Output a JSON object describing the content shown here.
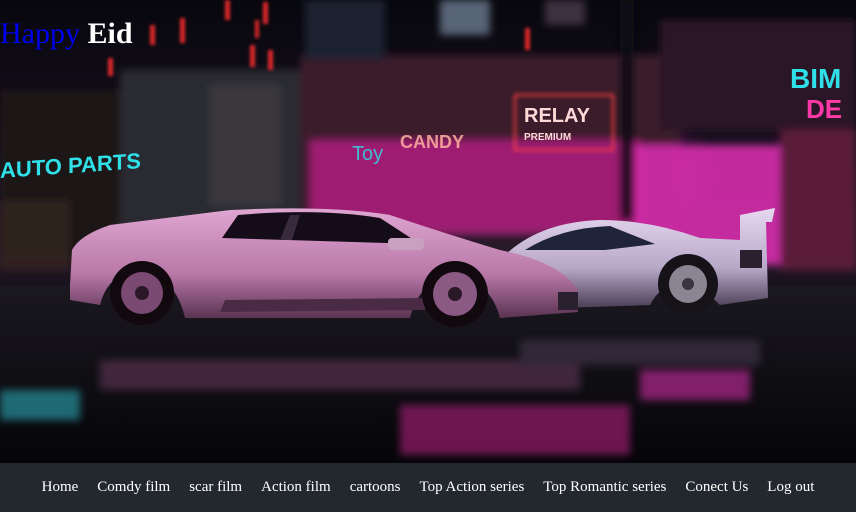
{
  "header": {
    "title_word_1": "Happy",
    "title_word_2": "Eid"
  },
  "hero": {
    "signs": {
      "auto_parts": "AUTO PARTS",
      "relay": "RELAY",
      "relay_sub": "PREMIUM",
      "toy": "Toy",
      "candy": "CANDY",
      "bim": "BIM",
      "bim_sub": "DE"
    },
    "colors": {
      "neon_pink": "#ff2bd6",
      "neon_cyan": "#2fe0e8",
      "neon_red": "#ff3a3a",
      "car_body": "#c88ab8"
    }
  },
  "nav": {
    "items": [
      {
        "label": "Home"
      },
      {
        "label": "Comdy film"
      },
      {
        "label": "scar film"
      },
      {
        "label": "Action film"
      },
      {
        "label": "cartoons"
      },
      {
        "label": "Top Action series"
      },
      {
        "label": "Top Romantic series"
      },
      {
        "label": "Conect Us"
      },
      {
        "label": "Log out"
      }
    ],
    "background": "#22282d"
  }
}
